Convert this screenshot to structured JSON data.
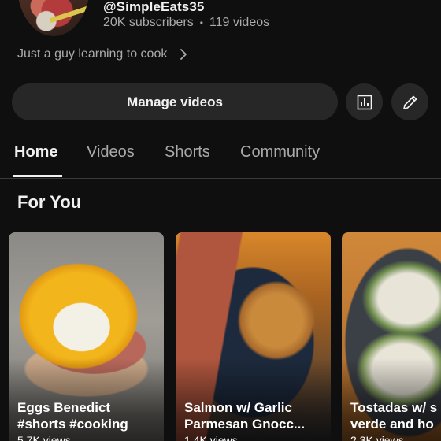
{
  "channel": {
    "handle": "@SimpleEats35",
    "subscribers": "20K subscribers",
    "separator": "•",
    "videos": "119 videos",
    "tagline": "Just a guy learning to cook"
  },
  "actions": {
    "manage_label": "Manage videos"
  },
  "tabs": [
    {
      "label": "Home",
      "active": true
    },
    {
      "label": "Videos",
      "active": false
    },
    {
      "label": "Shorts",
      "active": false
    },
    {
      "label": "Community",
      "active": false
    }
  ],
  "section": {
    "title": "For You"
  },
  "shorts": [
    {
      "title": "Eggs Benedict\n#shorts #cooking",
      "views": "5.7K views"
    },
    {
      "title": "Salmon w/ Garlic\nParmesan Gnocc...",
      "views": "1.4K views"
    },
    {
      "title": "Tostadas w/ s\nverde and ho",
      "views": "2.3K views"
    }
  ],
  "icons": {
    "tagline_more": "chevron-right-icon",
    "analytics": "bar-chart-icon",
    "edit": "pencil-icon"
  },
  "colors": {
    "background": "#0f0f0f",
    "button": "#272727",
    "text_primary": "#f1f1f1",
    "text_secondary": "#aaaaaa"
  }
}
